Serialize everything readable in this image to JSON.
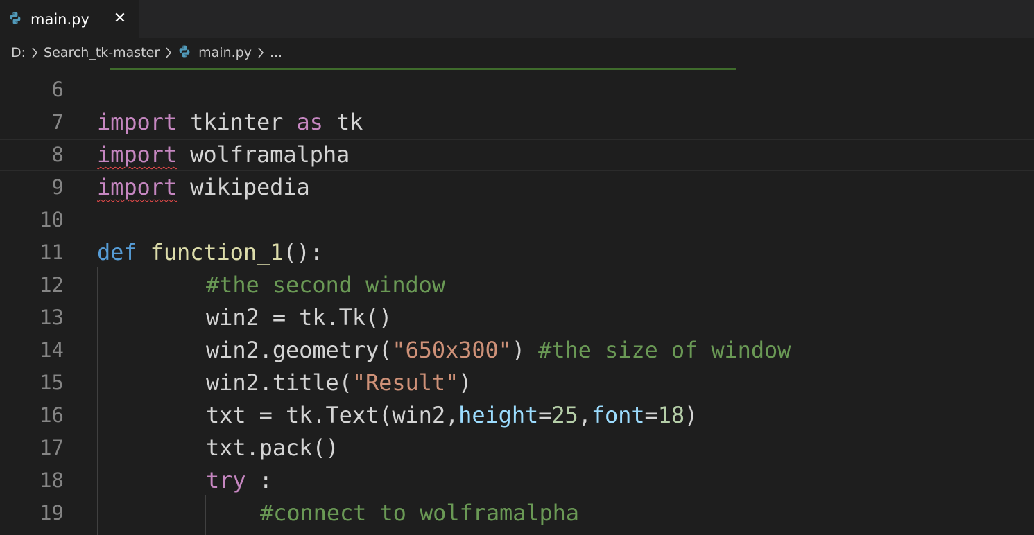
{
  "tab": {
    "filename": "main.py",
    "close_glyph": "✕",
    "icon": "python-icon"
  },
  "breadcrumbs": {
    "drive": "D:",
    "folder": "Search_tk-master",
    "file": "main.py",
    "more": "..."
  },
  "editor": {
    "current_line": "8",
    "lines": [
      {
        "number": "6"
      },
      {
        "number": "7",
        "kw1": "import",
        "t1": " tkinter ",
        "kw2": "as",
        "t2": " tk"
      },
      {
        "number": "8",
        "kw": "import",
        "rest": " wolframalpha"
      },
      {
        "number": "9",
        "kw": "import",
        "rest": " wikipedia"
      },
      {
        "number": "10"
      },
      {
        "number": "11",
        "kw": "def",
        "fn": " function_1",
        "rest": "():"
      },
      {
        "number": "12",
        "comment": "#the second window"
      },
      {
        "number": "13",
        "code": "win2 = tk.Tk()"
      },
      {
        "number": "14",
        "pre": "win2.geometry(",
        "str": "\"650x300\"",
        "post": ") ",
        "comment": "#the size of window"
      },
      {
        "number": "15",
        "pre": "win2.title(",
        "str": "\"Result\"",
        "post": ")"
      },
      {
        "number": "16",
        "pre": "txt = tk.Text(win2,",
        "p1": "height",
        "eq1": "=",
        "n1": "25",
        "comma": ",",
        "p2": "font",
        "eq2": "=",
        "n2": "18",
        "post": ")"
      },
      {
        "number": "17",
        "code": "txt.pack()"
      },
      {
        "number": "18",
        "kw": "try",
        "rest": " :"
      },
      {
        "number": "19",
        "comment": "#connect to wolframalpha"
      }
    ]
  },
  "colors": {
    "background": "#1e1e1e",
    "keyword_control": "#c586c0",
    "keyword_storage": "#569cd6",
    "function": "#dcdcaa",
    "comment": "#6a9955",
    "string": "#ce9178",
    "number": "#b5cea8",
    "parameter": "#9cdcfe"
  }
}
